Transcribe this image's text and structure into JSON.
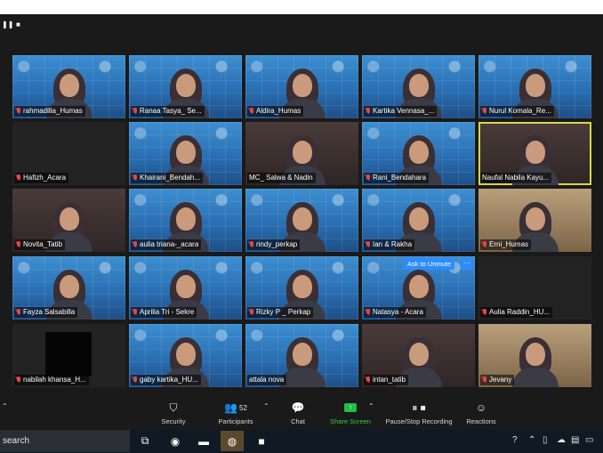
{
  "window": {
    "top_icons": [
      "pause-icon",
      "stop-icon"
    ]
  },
  "participants": [
    {
      "name": "rahmadilla_Humas",
      "bg": "zoom",
      "muted": true
    },
    {
      "name": "Ranaa Tasya_ Se...",
      "bg": "zoom",
      "muted": true
    },
    {
      "name": "Aldira_Humas",
      "bg": "zoom",
      "muted": true
    },
    {
      "name": "Kartika Vennasa_...",
      "bg": "zoom",
      "muted": true
    },
    {
      "name": "Nurul Komala_Re...",
      "bg": "zoom",
      "muted": true
    },
    {
      "name": "Hafizh_Acara",
      "bg": "dark",
      "muted": true
    },
    {
      "name": "Khairani_Bendah...",
      "bg": "zoom",
      "muted": true
    },
    {
      "name": "MC_ Salwa & Nadin",
      "bg": "room",
      "muted": false
    },
    {
      "name": "Rani_Bendahara",
      "bg": "zoom",
      "muted": true
    },
    {
      "name": "Naufal Nabila Kayu...",
      "bg": "room",
      "muted": false,
      "active": true
    },
    {
      "name": "Novita_Tatib",
      "bg": "room",
      "muted": true
    },
    {
      "name": "aulia triana-_acara",
      "bg": "zoom",
      "muted": true
    },
    {
      "name": "rindy_perkap",
      "bg": "zoom",
      "muted": true
    },
    {
      "name": "Ian & Rakha",
      "bg": "zoom",
      "muted": true
    },
    {
      "name": "Erni_Humas",
      "bg": "beige",
      "muted": true
    },
    {
      "name": "Fayza Salsabilla",
      "bg": "zoom",
      "muted": true
    },
    {
      "name": "Aprilia Tri - Sekre",
      "bg": "zoom",
      "muted": true
    },
    {
      "name": "Rizky P _ Perkap",
      "bg": "zoom",
      "muted": true
    },
    {
      "name": "Natasya - Acara",
      "bg": "zoom",
      "muted": true
    },
    {
      "name": "Aulia Raddin_HU...",
      "bg": "dark",
      "muted": true
    },
    {
      "name": "nabilah khansa_H...",
      "bg": "dark",
      "muted": true
    },
    {
      "name": "gaby kartika_HU...",
      "bg": "zoom",
      "muted": true
    },
    {
      "name": "attala nova",
      "bg": "zoom",
      "muted": false
    },
    {
      "name": "intan_tatib",
      "bg": "room",
      "muted": true
    },
    {
      "name": "Jevany",
      "bg": "beige",
      "muted": true
    }
  ],
  "overlay": {
    "ask_to_unmute": "Ask to Unmute",
    "more": "···"
  },
  "toolbar": {
    "security": "Security",
    "participants": "Participants",
    "participants_count": "52",
    "chat": "Chat",
    "share_screen": "Share Screen",
    "pause_stop_recording": "Pause/Stop Recording",
    "reactions": "Reactions"
  },
  "taskbar": {
    "search_text": "search"
  },
  "colors": {
    "active_speaker": "#d5d84b",
    "share_green": "#2ecc40",
    "unmute_blue": "#2d8cff",
    "mute_red": "#e64646"
  }
}
